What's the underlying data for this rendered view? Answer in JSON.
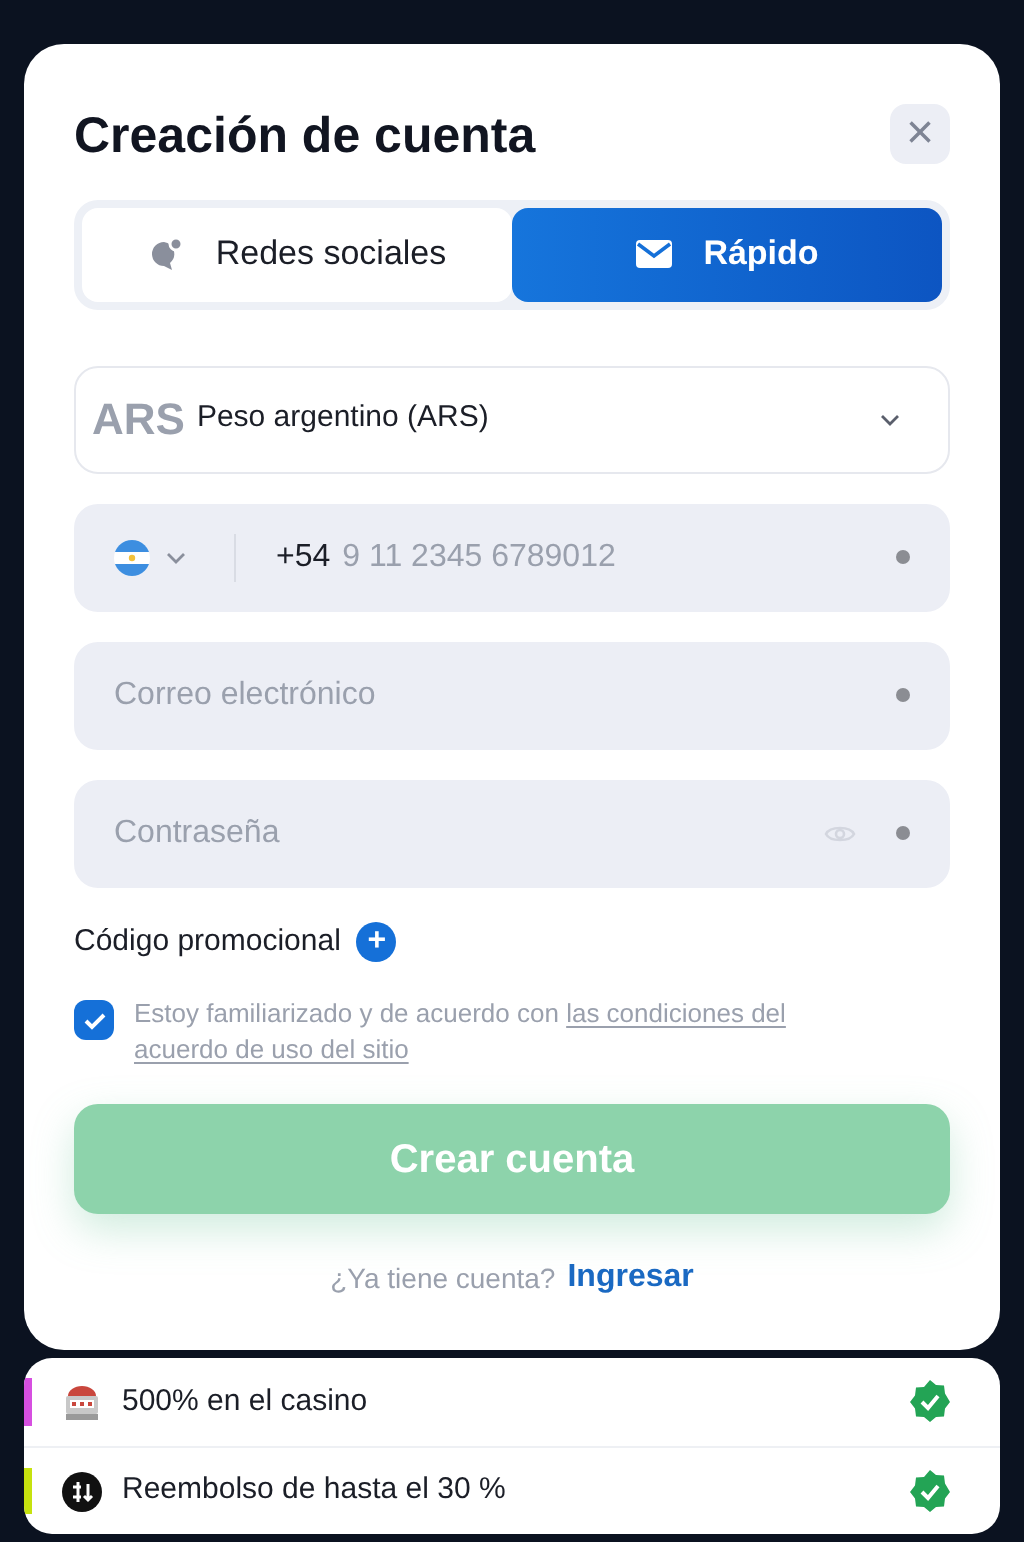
{
  "dialog": {
    "title": "Creación de cuenta",
    "close_label": "×"
  },
  "tabs": [
    {
      "label": "Redes sociales",
      "kind": "social",
      "selected": false
    },
    {
      "label": "Rápido",
      "kind": "mail",
      "selected": true
    }
  ],
  "currency": {
    "code": "ARS",
    "name": "Peso argentino (ARS)"
  },
  "fields": [
    {
      "kind": "phone",
      "prefix": "+54",
      "placeholder": "9 11 2345 6789012",
      "required": true
    },
    {
      "kind": "email",
      "placeholder": "Correo electrónico",
      "required": true
    },
    {
      "kind": "password",
      "placeholder": "Contraseña",
      "required": true
    }
  ],
  "promo": {
    "label": "Código promocional",
    "icon": "+"
  },
  "agreement": {
    "checked": true,
    "text": "Estoy familiarizado y de acuerdo con",
    "link_lines": [
      "las condiciones del",
      "acuerdo de uso del sitio"
    ]
  },
  "submit": {
    "label": "Crear cuenta",
    "disabled": true
  },
  "login": {
    "text": "¿Ya tiene cuenta?",
    "link": "Ingresar"
  },
  "bonuses": [
    {
      "kind": "casino",
      "label": "500% en el casino",
      "color": "#d64fe0",
      "checked": true
    },
    {
      "kind": "cashback",
      "label": "Reembolso de hasta el 30 %",
      "color": "#c6e20e",
      "checked": true
    }
  ]
}
